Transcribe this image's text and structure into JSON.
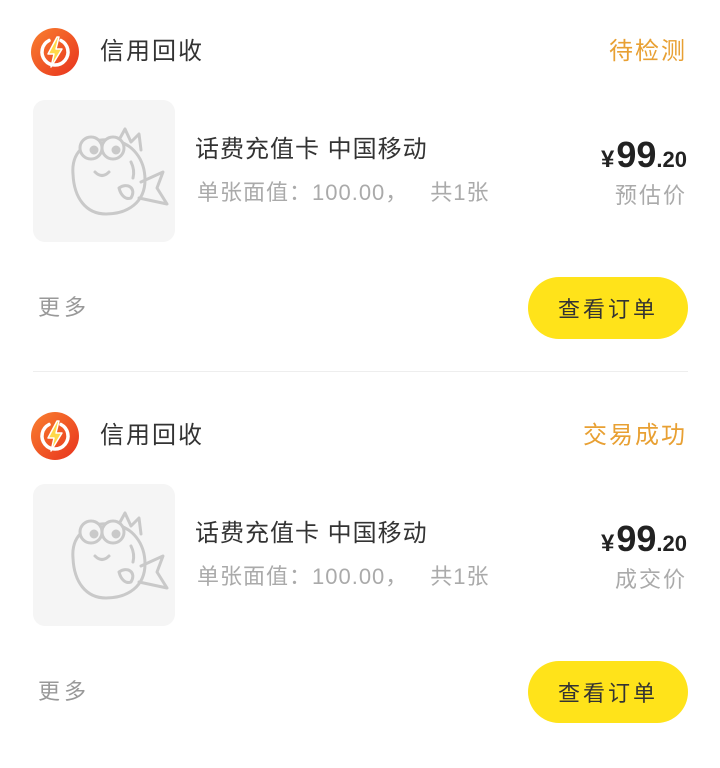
{
  "colors": {
    "status_text": "#E8A033",
    "action_button": "#FFE31A",
    "logo_gradient": [
      "#F9802F",
      "#E8321E"
    ],
    "primary_text": "#333333",
    "muted_text": "#AAAAAA",
    "thumbnail_bg": "#F5F5F5"
  },
  "orders": [
    {
      "merchant": {
        "name": "信用回收",
        "logo_icon": "lightning-bolt-icon"
      },
      "status": "待检测",
      "product": {
        "image_icon": "fish-placeholder-icon",
        "title": "话费充值卡 中国移动",
        "face_value": "单张面值：100.00，",
        "quantity": "共1张"
      },
      "price": {
        "currency": "¥",
        "integer": "99",
        "decimal": ".20",
        "label": "预估价"
      },
      "more_label": "更多",
      "action_label": "查看订单"
    },
    {
      "merchant": {
        "name": "信用回收",
        "logo_icon": "lightning-bolt-icon"
      },
      "status": "交易成功",
      "product": {
        "image_icon": "fish-placeholder-icon",
        "title": "话费充值卡 中国移动",
        "face_value": "单张面值：100.00，",
        "quantity": "共1张"
      },
      "price": {
        "currency": "¥",
        "integer": "99",
        "decimal": ".20",
        "label": "成交价"
      },
      "more_label": "更多",
      "action_label": "查看订单"
    }
  ]
}
